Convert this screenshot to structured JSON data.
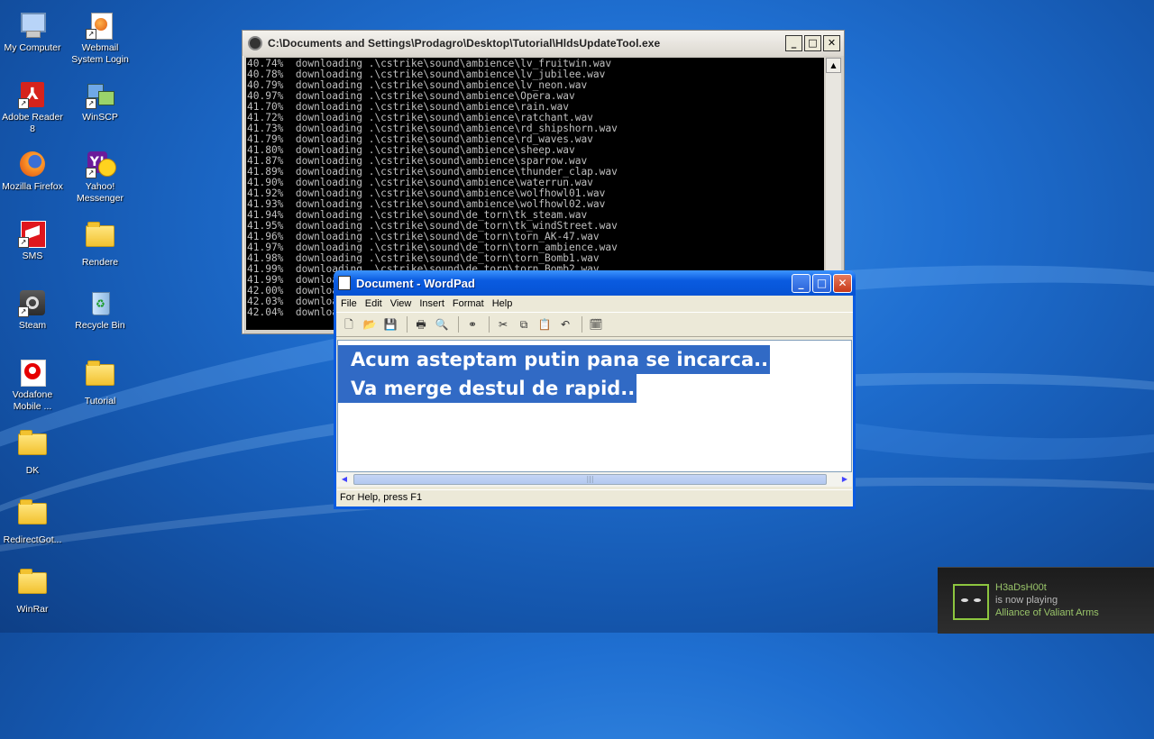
{
  "desktop": {
    "icons": [
      {
        "label": "My Computer",
        "icon": "my-computer-icon"
      },
      {
        "label": "Webmail System Login",
        "icon": "firefox-shortcut-icon"
      },
      {
        "label": "Adobe Reader 8",
        "icon": "adobe-reader-icon"
      },
      {
        "label": "WinSCP",
        "icon": "winscp-icon"
      },
      {
        "label": "Mozilla Firefox",
        "icon": "firefox-icon"
      },
      {
        "label": "Yahoo! Messenger",
        "icon": "yahoo-messenger-icon"
      },
      {
        "label": "SMS",
        "icon": "sms-icon"
      },
      {
        "label": "Rendere",
        "icon": "folder-icon"
      },
      {
        "label": "Steam",
        "icon": "steam-icon"
      },
      {
        "label": "Recycle Bin",
        "icon": "recycle-bin-icon"
      },
      {
        "label": "Vodafone Mobile ...",
        "icon": "vodafone-icon"
      },
      {
        "label": "Tutorial",
        "icon": "folder-icon"
      },
      {
        "label": "DK",
        "icon": "folder-icon"
      },
      {
        "label": "RedirectGot...",
        "icon": "folder-icon"
      },
      {
        "label": "WinRar",
        "icon": "folder-icon"
      }
    ]
  },
  "console": {
    "title": "C:\\Documents and Settings\\Prodagro\\Desktop\\Tutorial\\HldsUpdateTool.exe",
    "output": "40.74%  downloading .\\cstrike\\sound\\ambience\\lv_fruitwin.wav\n40.78%  downloading .\\cstrike\\sound\\ambience\\lv_jubilee.wav\n40.79%  downloading .\\cstrike\\sound\\ambience\\lv_neon.wav\n40.97%  downloading .\\cstrike\\sound\\ambience\\Opera.wav\n41.70%  downloading .\\cstrike\\sound\\ambience\\rain.wav\n41.72%  downloading .\\cstrike\\sound\\ambience\\ratchant.wav\n41.73%  downloading .\\cstrike\\sound\\ambience\\rd_shipshorn.wav\n41.79%  downloading .\\cstrike\\sound\\ambience\\rd_waves.wav\n41.80%  downloading .\\cstrike\\sound\\ambience\\sheep.wav\n41.87%  downloading .\\cstrike\\sound\\ambience\\sparrow.wav\n41.89%  downloading .\\cstrike\\sound\\ambience\\thunder_clap.wav\n41.90%  downloading .\\cstrike\\sound\\ambience\\waterrun.wav\n41.92%  downloading .\\cstrike\\sound\\ambience\\wolfhowl01.wav\n41.93%  downloading .\\cstrike\\sound\\ambience\\wolfhowl02.wav\n41.94%  downloading .\\cstrike\\sound\\de_torn\\tk_steam.wav\n41.95%  downloading .\\cstrike\\sound\\de_torn\\tk_windStreet.wav\n41.96%  downloading .\\cstrike\\sound\\de_torn\\torn_AK-47.wav\n41.97%  downloading .\\cstrike\\sound\\de_torn\\torn_ambience.wav\n41.98%  downloading .\\cstrike\\sound\\de_torn\\torn_Bomb1.wav\n41.99%  downloading .\\cstrike\\sound\\de_torn\\torn_Bomb2.wav\n41.99%  downloading\n42.00%  downloading\n42.03%  downloading\n42.04%  downloading"
  },
  "wordpad": {
    "title": "Document - WordPad",
    "menu": [
      "File",
      "Edit",
      "View",
      "Insert",
      "Format",
      "Help"
    ],
    "lines": [
      "Acum asteptam putin pana se incarca..",
      "Va merge destul de rapid.."
    ],
    "status": "For Help, press F1",
    "selection_color": "#316ac5"
  },
  "notification": {
    "user": "H3aDsH00t",
    "action": "is now playing",
    "game": "Alliance of Valiant Arms",
    "accent": "#8dc63f"
  }
}
